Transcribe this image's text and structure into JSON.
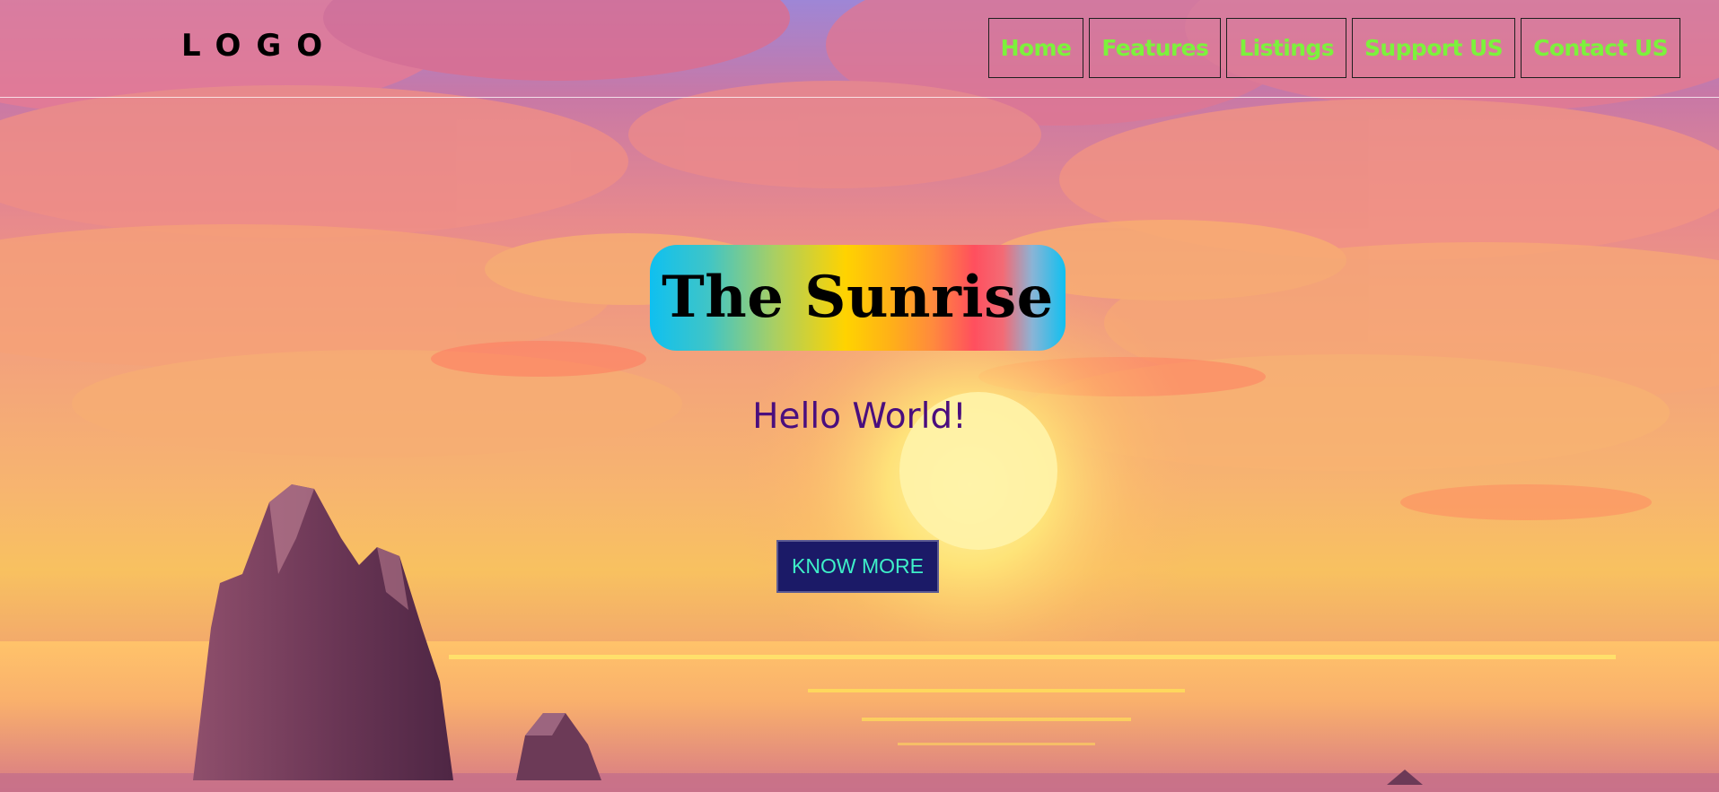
{
  "header": {
    "logo_text": "LOGO",
    "nav": [
      {
        "label": "Home"
      },
      {
        "label": "Features"
      },
      {
        "label": "Listings"
      },
      {
        "label": "Support US"
      },
      {
        "label": "Contact US"
      }
    ]
  },
  "hero": {
    "title": "The Sunrise",
    "subtitle": "Hello World!",
    "cta_label": "KNOW MORE"
  },
  "colors": {
    "nav_text": "#7cf23c",
    "subtitle_text": "#4a0e7e",
    "cta_background": "#1b1a67",
    "cta_text": "#3ef0c8"
  },
  "background": {
    "scene": "sunset-over-sea-with-clouds-and-rocks"
  }
}
